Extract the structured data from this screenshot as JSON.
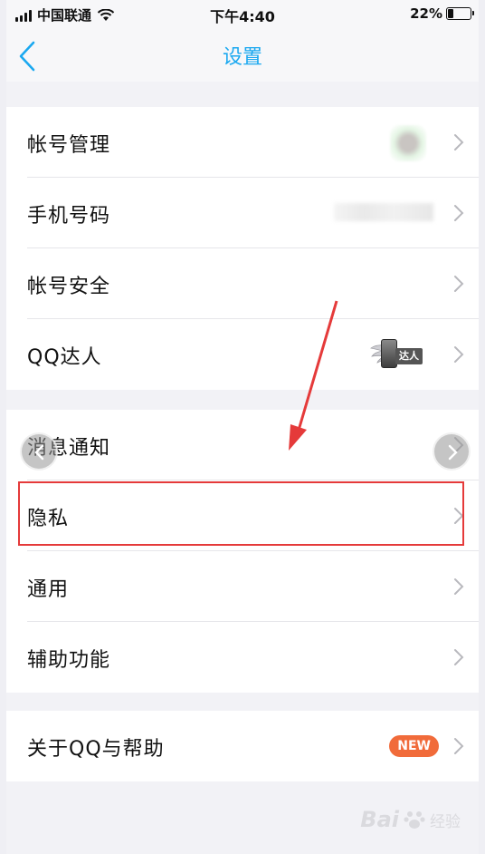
{
  "status_bar": {
    "carrier": "中国联通",
    "time": "下午4:40",
    "battery": "22%",
    "battery_fraction": 0.22
  },
  "nav": {
    "title": "设置"
  },
  "groups": {
    "account": {
      "items": [
        {
          "label": "帐号管理"
        },
        {
          "label": "手机号码"
        },
        {
          "label": "帐号安全"
        },
        {
          "label": "QQ达人",
          "badge": "达人"
        }
      ]
    },
    "settings": {
      "items": [
        {
          "label": "消息通知"
        },
        {
          "label": "隐私"
        },
        {
          "label": "通用"
        },
        {
          "label": "辅助功能"
        }
      ]
    },
    "about": {
      "items": [
        {
          "label": "关于QQ与帮助",
          "badge": "NEW"
        }
      ]
    }
  },
  "colors": {
    "accent": "#1aa8f0",
    "highlight": "#e53a3a",
    "new_badge": "#f16b3a"
  },
  "watermark": {
    "brand": "Bai",
    "suffix": "经验"
  }
}
